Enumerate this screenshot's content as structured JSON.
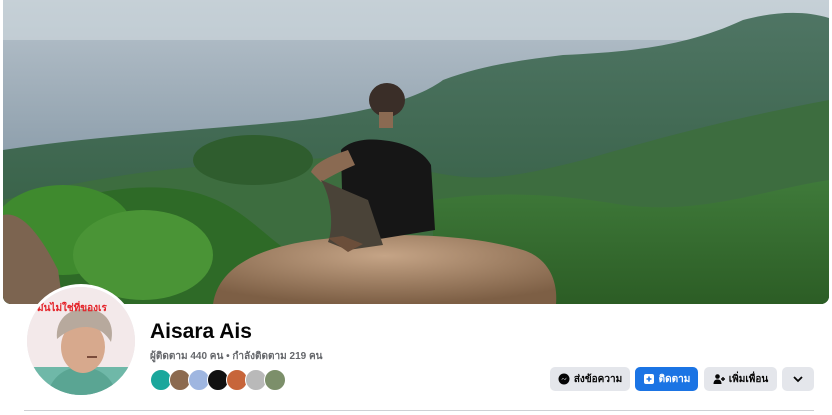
{
  "profile": {
    "name": "Aisara Ais",
    "stats": "ผู้ติดตาม 440 คน • กำลังติดตาม 219 คน",
    "avatar_caption": "มันไม่ใช่ที่ของเร"
  },
  "actions": {
    "message_label": "ส่งข้อความ",
    "follow_label": "ติดตาม",
    "add_friend_label": "เพิ่มเพื่อน"
  },
  "mutual_friends": [
    {
      "name": "mutual-friend-1",
      "color": "#1aa79c"
    },
    {
      "name": "mutual-friend-2",
      "color": "#8c6a4f"
    },
    {
      "name": "mutual-friend-3",
      "color": "#9fb6e0"
    },
    {
      "name": "mutual-friend-4",
      "color": "#111111"
    },
    {
      "name": "mutual-friend-5",
      "color": "#c7653a"
    },
    {
      "name": "mutual-friend-6",
      "color": "#b9b9b9"
    },
    {
      "name": "mutual-friend-7",
      "color": "#7c8f6a"
    }
  ],
  "colors": {
    "accent": "#1b74e4",
    "button_gray": "#e4e6eb",
    "text_primary": "#050505",
    "text_secondary": "#65676b"
  },
  "icons": {
    "message": "messenger-icon",
    "follow": "follow-plus-icon",
    "add_friend": "add-friend-icon",
    "more": "chevron-down-icon"
  }
}
